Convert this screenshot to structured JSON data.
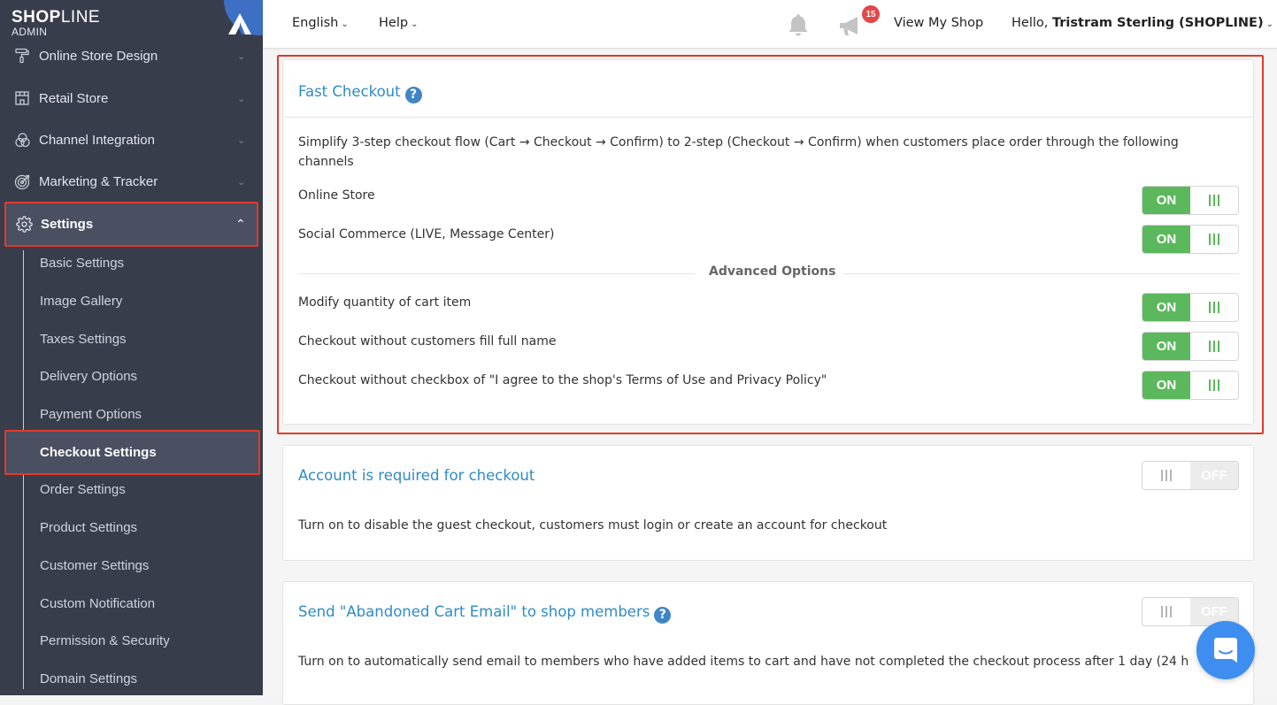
{
  "logo": {
    "brand_bold": "SHOP",
    "brand_light": "LINE",
    "subtitle": "ADMIN"
  },
  "sidebar": {
    "items": [
      {
        "label": "Online Store Design",
        "icon": "paint-roller-icon",
        "expanded": false
      },
      {
        "label": "Retail Store",
        "icon": "store-icon",
        "expanded": false
      },
      {
        "label": "Channel Integration",
        "icon": "channels-icon",
        "expanded": false
      },
      {
        "label": "Marketing & Tracker",
        "icon": "target-icon",
        "expanded": false
      },
      {
        "label": "Settings",
        "icon": "gear-icon",
        "expanded": true,
        "active": true
      }
    ],
    "settings_sub_items": [
      "Basic Settings",
      "Image Gallery",
      "Taxes Settings",
      "Delivery Options",
      "Payment Options",
      "Checkout Settings",
      "Order Settings",
      "Product Settings",
      "Customer Settings",
      "Custom Notification",
      "Permission & Security",
      "Domain Settings"
    ],
    "active_sub_item": "Checkout Settings"
  },
  "header": {
    "language": "English",
    "help": "Help",
    "notification_badge": "15",
    "view_shop": "View My Shop",
    "greeting": "Hello,",
    "user_name": "Tristram Sterling (SHOPLINE)"
  },
  "fast_checkout": {
    "title": "Fast Checkout",
    "description": "Simplify 3-step checkout flow (Cart → Checkout → Confirm) to 2-step (Checkout → Confirm) when customers place order through the following channels",
    "channels": [
      {
        "label": "Online Store",
        "state": "ON"
      },
      {
        "label": "Social Commerce (LIVE, Message Center)",
        "state": "ON"
      }
    ],
    "advanced_title": "Advanced Options",
    "advanced": [
      {
        "label": "Modify quantity of cart item",
        "state": "ON"
      },
      {
        "label": "Checkout without customers fill full name",
        "state": "ON"
      },
      {
        "label": "Checkout without checkbox of \"I agree to the shop's Terms of Use and Privacy Policy\"",
        "state": "ON"
      }
    ]
  },
  "account_required": {
    "title": "Account is required for checkout",
    "state": "OFF",
    "description": "Turn on to disable the guest checkout, customers must login or create an account for checkout"
  },
  "abandoned_cart": {
    "title": "Send \"Abandoned Cart Email\" to shop members",
    "state": "OFF",
    "description": "Turn on to automatically send email to members who have added items to cart and have not completed the checkout process after 1 day (24 h"
  },
  "colors": {
    "accent": "#2f8bc5",
    "toggle_on": "#5cb85c",
    "highlight": "#e03a2a",
    "sidebar_bg": "#383d4c"
  }
}
